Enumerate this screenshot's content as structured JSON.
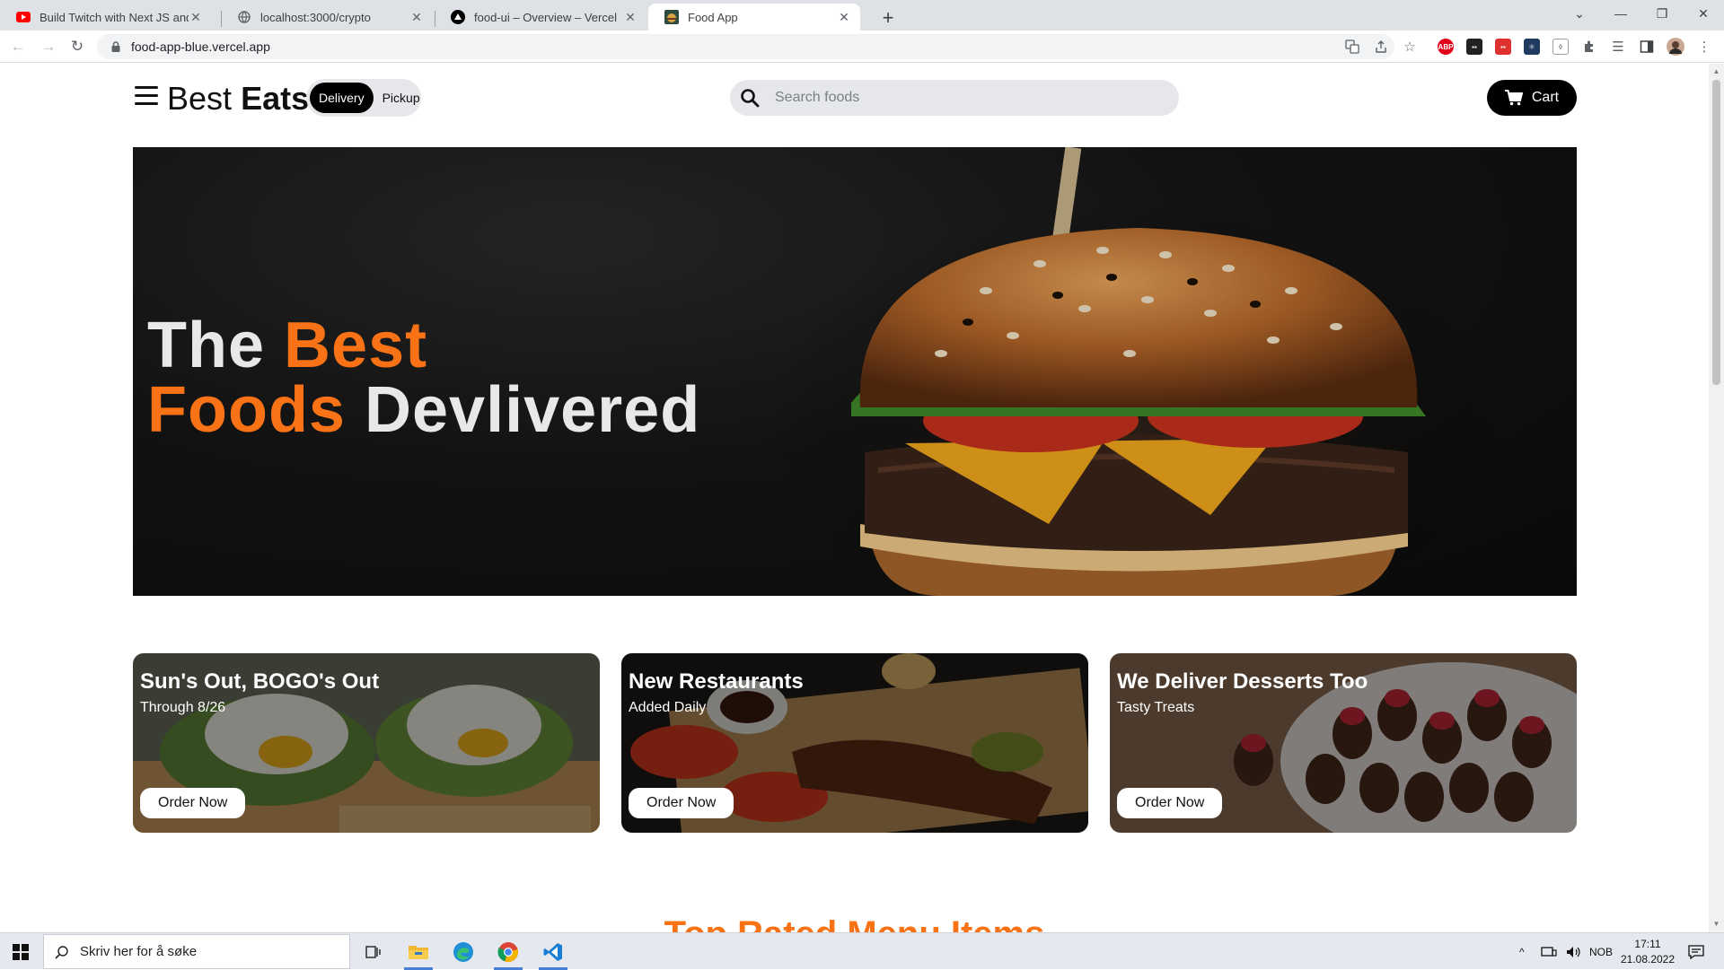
{
  "browser": {
    "tabs": [
      {
        "title": "Build Twitch with Next JS and Tailwind",
        "favicon": "youtube-icon",
        "active": false
      },
      {
        "title": "localhost:3000/crypto",
        "favicon": "globe-icon",
        "active": false
      },
      {
        "title": "food-ui – Overview – Vercel",
        "favicon": "vercel-icon",
        "active": false
      },
      {
        "title": "Food App",
        "favicon": "food-app-icon",
        "active": true
      }
    ],
    "url": "food-app-blue.vercel.app"
  },
  "header": {
    "brand_light": "Best",
    "brand_bold": "Eats",
    "toggle": {
      "delivery": "Delivery",
      "pickup": "Pickup",
      "selected": "Delivery"
    },
    "search_placeholder": "Search foods",
    "cart_label": "Cart"
  },
  "hero": {
    "line1_white": "The",
    "line1_orange": "Best",
    "line2_orange": "Foods",
    "line2_white": "Devlivered"
  },
  "cards": [
    {
      "title": "Sun's Out, BOGO's Out",
      "subtitle": "Through 8/26",
      "button": "Order Now"
    },
    {
      "title": "New Restaurants",
      "subtitle": "Added Daily",
      "button": "Order Now"
    },
    {
      "title": "We Deliver Desserts Too",
      "subtitle": "Tasty Treats",
      "button": "Order Now"
    }
  ],
  "next_section_peek": "Top Rated Menu Items",
  "taskbar": {
    "search_placeholder": "Skriv her for å søke",
    "language": "NOB",
    "time": "17:11",
    "date": "21.08.2022"
  },
  "colors": {
    "accent_orange": "#f97316",
    "black": "#000000",
    "pill_gray": "#e5e7eb"
  }
}
